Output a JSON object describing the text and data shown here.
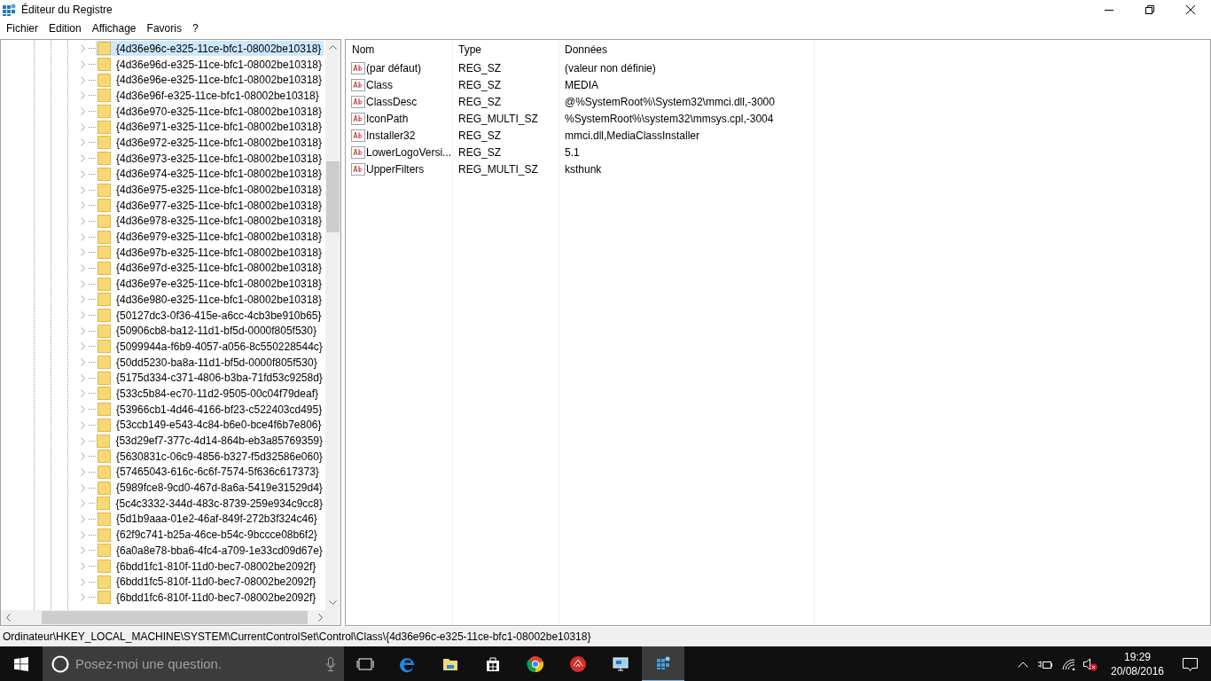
{
  "window": {
    "title": "Éditeur du Registre"
  },
  "menu": [
    "Fichier",
    "Edition",
    "Affichage",
    "Favoris",
    "?"
  ],
  "tree": {
    "items": [
      {
        "label": "{4d36e96c-e325-11ce-bfc1-08002be10318}",
        "selected": true
      },
      {
        "label": "{4d36e96d-e325-11ce-bfc1-08002be10318}",
        "selected": false
      },
      {
        "label": "{4d36e96e-e325-11ce-bfc1-08002be10318}",
        "selected": false
      },
      {
        "label": "{4d36e96f-e325-11ce-bfc1-08002be10318}",
        "selected": false
      },
      {
        "label": "{4d36e970-e325-11ce-bfc1-08002be10318}",
        "selected": false
      },
      {
        "label": "{4d36e971-e325-11ce-bfc1-08002be10318}",
        "selected": false
      },
      {
        "label": "{4d36e972-e325-11ce-bfc1-08002be10318}",
        "selected": false
      },
      {
        "label": "{4d36e973-e325-11ce-bfc1-08002be10318}",
        "selected": false
      },
      {
        "label": "{4d36e974-e325-11ce-bfc1-08002be10318}",
        "selected": false
      },
      {
        "label": "{4d36e975-e325-11ce-bfc1-08002be10318}",
        "selected": false
      },
      {
        "label": "{4d36e977-e325-11ce-bfc1-08002be10318}",
        "selected": false
      },
      {
        "label": "{4d36e978-e325-11ce-bfc1-08002be10318}",
        "selected": false
      },
      {
        "label": "{4d36e979-e325-11ce-bfc1-08002be10318}",
        "selected": false
      },
      {
        "label": "{4d36e97b-e325-11ce-bfc1-08002be10318}",
        "selected": false
      },
      {
        "label": "{4d36e97d-e325-11ce-bfc1-08002be10318}",
        "selected": false
      },
      {
        "label": "{4d36e97e-e325-11ce-bfc1-08002be10318}",
        "selected": false
      },
      {
        "label": "{4d36e980-e325-11ce-bfc1-08002be10318}",
        "selected": false
      },
      {
        "label": "{50127dc3-0f36-415e-a6cc-4cb3be910b65}",
        "selected": false
      },
      {
        "label": "{50906cb8-ba12-11d1-bf5d-0000f805f530}",
        "selected": false
      },
      {
        "label": "{5099944a-f6b9-4057-a056-8c550228544c}",
        "selected": false
      },
      {
        "label": "{50dd5230-ba8a-11d1-bf5d-0000f805f530}",
        "selected": false
      },
      {
        "label": "{5175d334-c371-4806-b3ba-71fd53c9258d}",
        "selected": false
      },
      {
        "label": "{533c5b84-ec70-11d2-9505-00c04f79deaf}",
        "selected": false
      },
      {
        "label": "{53966cb1-4d46-4166-bf23-c522403cd495}",
        "selected": false
      },
      {
        "label": "{53ccb149-e543-4c84-b6e0-bce4f6b7e806}",
        "selected": false
      },
      {
        "label": "{53d29ef7-377c-4d14-864b-eb3a85769359}",
        "selected": false
      },
      {
        "label": "{5630831c-06c9-4856-b327-f5d32586e060}",
        "selected": false
      },
      {
        "label": "{57465043-616c-6c6f-7574-5f636c617373}",
        "selected": false
      },
      {
        "label": "{5989fce8-9cd0-467d-8a6a-5419e31529d4}",
        "selected": false
      },
      {
        "label": "{5c4c3332-344d-483c-8739-259e934c9cc8}",
        "selected": false
      },
      {
        "label": "{5d1b9aaa-01e2-46af-849f-272b3f324c46}",
        "selected": false
      },
      {
        "label": "{62f9c741-b25a-46ce-b54c-9bccce08b6f2}",
        "selected": false
      },
      {
        "label": "{6a0a8e78-bba6-4fc4-a709-1e33cd09d67e}",
        "selected": false
      },
      {
        "label": "{6bdd1fc1-810f-11d0-bec7-08002be2092f}",
        "selected": false
      },
      {
        "label": "{6bdd1fc5-810f-11d0-bec7-08002be2092f}",
        "selected": false
      },
      {
        "label": "{6bdd1fc6-810f-11d0-bec7-08002be2092f}",
        "selected": false
      }
    ]
  },
  "values": {
    "columns": [
      "Nom",
      "Type",
      "Données"
    ],
    "rows": [
      {
        "name": "(par défaut)",
        "type": "REG_SZ",
        "data": "(valeur non définie)"
      },
      {
        "name": "Class",
        "type": "REG_SZ",
        "data": "MEDIA"
      },
      {
        "name": "ClassDesc",
        "type": "REG_SZ",
        "data": "@%SystemRoot%\\System32\\mmci.dll,-3000"
      },
      {
        "name": "IconPath",
        "type": "REG_MULTI_SZ",
        "data": "%SystemRoot%\\system32\\mmsys.cpl,-3004"
      },
      {
        "name": "Installer32",
        "type": "REG_SZ",
        "data": "mmci.dll,MediaClassInstaller"
      },
      {
        "name": "LowerLogoVersi...",
        "type": "REG_SZ",
        "data": "5.1"
      },
      {
        "name": "UpperFilters",
        "type": "REG_MULTI_SZ",
        "data": "ksthunk"
      }
    ]
  },
  "status_bar": "Ordinateur\\HKEY_LOCAL_MACHINE\\SYSTEM\\CurrentControlSet\\Control\\Class\\{4d36e96c-e325-11ce-bfc1-08002be10318}",
  "taskbar": {
    "search": {
      "placeholder": "Posez-moi une question."
    },
    "apps": [
      {
        "kind": "taskview",
        "selected": false
      },
      {
        "kind": "edge",
        "selected": false
      },
      {
        "kind": "explorer",
        "selected": false
      },
      {
        "kind": "store",
        "selected": false
      },
      {
        "kind": "chrome",
        "selected": false
      },
      {
        "kind": "red",
        "selected": false
      },
      {
        "kind": "monitor",
        "selected": false
      },
      {
        "kind": "regedit",
        "selected": true
      }
    ],
    "time": "19:29",
    "date": "20/08/2016"
  }
}
